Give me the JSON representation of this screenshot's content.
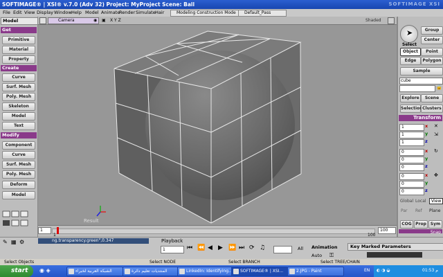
{
  "window": {
    "title": "SOFTIMAGE® | XSI® v.7.0 (Adv 32) Project: MyProject   Scene: Ball",
    "brand": "SOFTIMAGE XSI"
  },
  "menu": {
    "items": [
      "File",
      "Edit",
      "View",
      "Display",
      "Window",
      "Help",
      "Model",
      "Animate",
      "Render",
      "Simulate",
      "Hair"
    ],
    "mode_dropdown": "Modeling Construction Mode",
    "pass_dropdown": "Default_Pass"
  },
  "left_panel": {
    "module_label": "Model",
    "sections": [
      {
        "title": "Get",
        "buttons": [
          "Primitive",
          "Material",
          "Property"
        ]
      },
      {
        "title": "Create",
        "buttons": [
          "Curve",
          "Surf. Mesh",
          "Poly. Mesh",
          "Skeleton",
          "Model",
          "Text"
        ]
      },
      {
        "title": "Modify",
        "buttons": [
          "Component",
          "Curve",
          "Surf. Mesh",
          "Poly. Mesh",
          "Deform",
          "Model"
        ]
      }
    ]
  },
  "viewport": {
    "camera_label": "Camera",
    "axes_label": "X Y Z",
    "display_mode": "Shaded",
    "overlay_label": "Result"
  },
  "right_panel": {
    "buttons": {
      "select": "Select",
      "group": "Group",
      "center": "Center",
      "object": "Object",
      "point": "Point",
      "edge": "Edge",
      "polygon": "Polygon",
      "sample": "Sample",
      "explore": "Explore",
      "scene": "Scene",
      "selection": "Selection",
      "clusters": "Clusters"
    },
    "object_name": "cube",
    "transform_label": "Transform",
    "scale": {
      "x": "1",
      "y": "1",
      "z": "1"
    },
    "rotate": {
      "x": "0",
      "y": "0",
      "z": "0"
    },
    "translate": {
      "x": "0",
      "y": "0",
      "z": "0"
    },
    "axis_letters": {
      "x": "x",
      "y": "y",
      "z": "z"
    },
    "ref_modes": [
      "Global",
      "Local",
      "View"
    ],
    "ref_modes_2": [
      "Par",
      "Ref",
      "Plane"
    ],
    "cog_buttons": [
      "COG",
      "Prop",
      "Sym"
    ],
    "snap_label": "Snap",
    "snap_modes": [
      "MCP",
      "KP/L",
      "MAT"
    ]
  },
  "timeline": {
    "start_frame": "1",
    "current_frame": "1",
    "end_frame": "100",
    "end_frame_2": "100",
    "scale_end": "100"
  },
  "bottom": {
    "script_line": "ng.transparency.green\",0.347",
    "playback_label": "Playback",
    "frame_field": "1",
    "all_label": "All",
    "animation_label": "Animation",
    "auto_label": "Auto",
    "key_marked": "Key Marked Parameters"
  },
  "status": {
    "left": "Select Objects",
    "mid1": "Select NODE",
    "mid2": "Select BRANCH",
    "mid3": "Select TREE/CHAIN"
  },
  "taskbar": {
    "start_label": "start",
    "tasks": [
      "الشبكة العربية لخبراء",
      "المنتديات تعليم دائرة",
      "LinkedIn: Identifying...",
      "SOFTIMAGE® | XSI...",
      "2.JPG - Paint"
    ],
    "language": "EN",
    "clock": "01:53 م"
  }
}
